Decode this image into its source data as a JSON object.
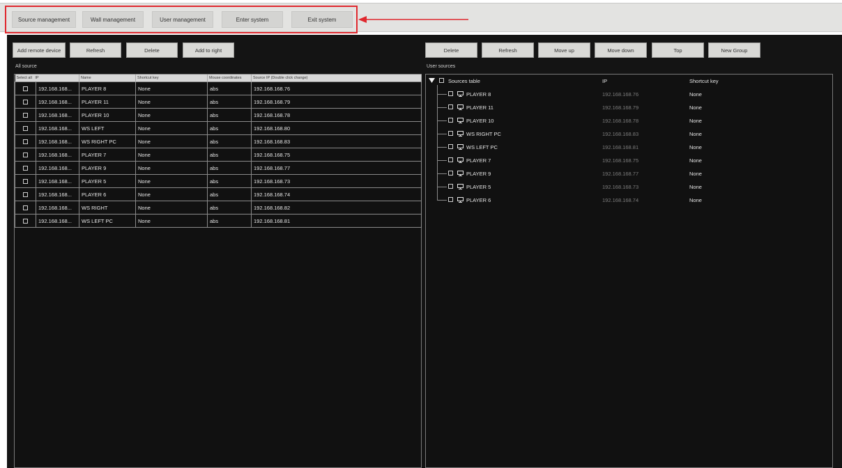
{
  "nav": {
    "source_management": "Source management",
    "wall_management": "Wall management",
    "user_management": "User management",
    "enter_system": "Enter system",
    "exit_system": "Exit system"
  },
  "colors": {
    "highlight": "#e0282e",
    "background": "#141414",
    "button": "#d9d9d6"
  },
  "left": {
    "buttons": {
      "add_remote": "Add remote device",
      "refresh": "Refresh",
      "delete": "Delete",
      "add_right": "Add to right"
    },
    "label": "All source",
    "columns": {
      "select_all": "Select all",
      "ip": "IP",
      "name": "Name",
      "shortcut": "Shortcut key",
      "mouse": "Mouse coordinates",
      "source_ip": "Source IP (Double click change)"
    },
    "rows": [
      {
        "ip": "192.168.168...",
        "name": "PLAYER 8",
        "key": "None",
        "mouse": "abs",
        "sip": "192.168.168.76"
      },
      {
        "ip": "192.168.168...",
        "name": "PLAYER 11",
        "key": "None",
        "mouse": "abs",
        "sip": "192.168.168.79"
      },
      {
        "ip": "192.168.168...",
        "name": "PLAYER 10",
        "key": "None",
        "mouse": "abs",
        "sip": "192.168.168.78"
      },
      {
        "ip": "192.168.168...",
        "name": "WS LEFT",
        "key": "None",
        "mouse": "abs",
        "sip": "192.168.168.80"
      },
      {
        "ip": "192.168.168...",
        "name": "WS RIGHT PC",
        "key": "None",
        "mouse": "abs",
        "sip": "192.168.168.83"
      },
      {
        "ip": "192.168.168...",
        "name": "PLAYER 7",
        "key": "None",
        "mouse": "abs",
        "sip": "192.168.168.75"
      },
      {
        "ip": "192.168.168...",
        "name": "PLAYER 9",
        "key": "None",
        "mouse": "abs",
        "sip": "192.168.168.77"
      },
      {
        "ip": "192.168.168...",
        "name": "PLAYER 5",
        "key": "None",
        "mouse": "abs",
        "sip": "192.168.168.73"
      },
      {
        "ip": "192.168.168...",
        "name": "PLAYER 6",
        "key": "None",
        "mouse": "abs",
        "sip": "192.168.168.74"
      },
      {
        "ip": "192.168.168...",
        "name": "WS RIGHT",
        "key": "None",
        "mouse": "abs",
        "sip": "192.168.168.82"
      },
      {
        "ip": "192.168.168...",
        "name": "WS LEFT PC",
        "key": "None",
        "mouse": "abs",
        "sip": "192.168.168.81"
      }
    ]
  },
  "right": {
    "buttons": {
      "delete": "Delete",
      "refresh": "Refresh",
      "move_up": "Move up",
      "move_down": "Move down",
      "top": "Top",
      "new_group": "New Group"
    },
    "label": "User sources",
    "root": "Sources table",
    "columns": {
      "ip": "IP",
      "shortcut": "Shortcut key"
    },
    "items": [
      {
        "name": "PLAYER 8",
        "ip": "192.168.168.76",
        "key": "None"
      },
      {
        "name": "PLAYER 11",
        "ip": "192.168.168.79",
        "key": "None"
      },
      {
        "name": "PLAYER 10",
        "ip": "192.168.168.78",
        "key": "None"
      },
      {
        "name": "WS RIGHT PC",
        "ip": "192.168.168.83",
        "key": "None"
      },
      {
        "name": "WS LEFT PC",
        "ip": "192.168.168.81",
        "key": "None"
      },
      {
        "name": "PLAYER 7",
        "ip": "192.168.168.75",
        "key": "None"
      },
      {
        "name": "PLAYER 9",
        "ip": "192.168.168.77",
        "key": "None"
      },
      {
        "name": "PLAYER 5",
        "ip": "192.168.168.73",
        "key": "None"
      },
      {
        "name": "PLAYER 6",
        "ip": "192.168.168.74",
        "key": "None"
      }
    ]
  }
}
